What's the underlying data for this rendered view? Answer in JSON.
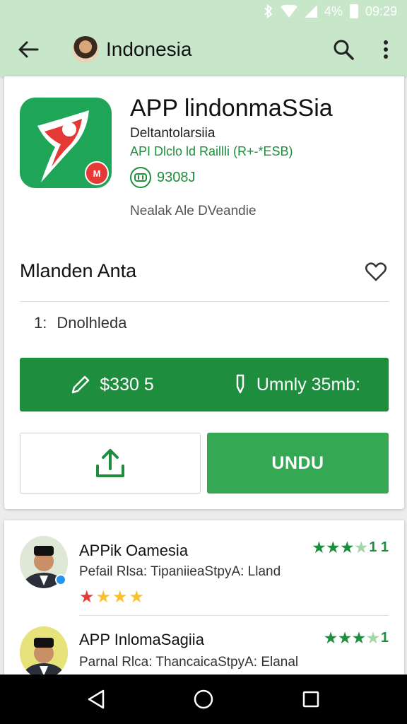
{
  "status_bar": {
    "battery": "4",
    "percent": "%",
    "time": "09:29",
    "icons": [
      "bluetooth-icon",
      "wifi-icon",
      "signal-icon",
      "battery-icon"
    ]
  },
  "app_bar": {
    "title": "Indonesia",
    "icons": [
      "back-arrow-icon",
      "search-icon",
      "more-vert-icon"
    ]
  },
  "app": {
    "name": "APP lindonmaSSia",
    "developer": "Deltantolarsiia",
    "category": "API Dlclo ld Raillli (R+-*ESB)",
    "rating_value": "9308J",
    "tagline": "Nealak Ale DVeandie",
    "icon_badge": "M"
  },
  "section": {
    "title": "Mlanden Anta",
    "info_number": "1:",
    "info_text": "Dnolhleda"
  },
  "price_bar": {
    "price": "$330 5",
    "size": "Umnly 35mb:"
  },
  "buttons": {
    "download_label": "UNDU"
  },
  "reviews": [
    {
      "name": "APPik Oamesia",
      "text": "Pefail Rlsa: TipaniieaStpyA: Lland",
      "score": "1 1",
      "green_stars": 3,
      "user_stars": 4
    },
    {
      "name": "APP InlomaSagiia",
      "text": "Parnal Rlca: ThancaicaStpyA: Elanal",
      "score": "1",
      "green_stars": 3
    }
  ],
  "colors": {
    "app_bar": "#c8e6c9",
    "primary_green": "#1e8e3e",
    "download_green": "#34a853",
    "star_red": "#e53935",
    "star_yellow": "#fbc02d"
  }
}
